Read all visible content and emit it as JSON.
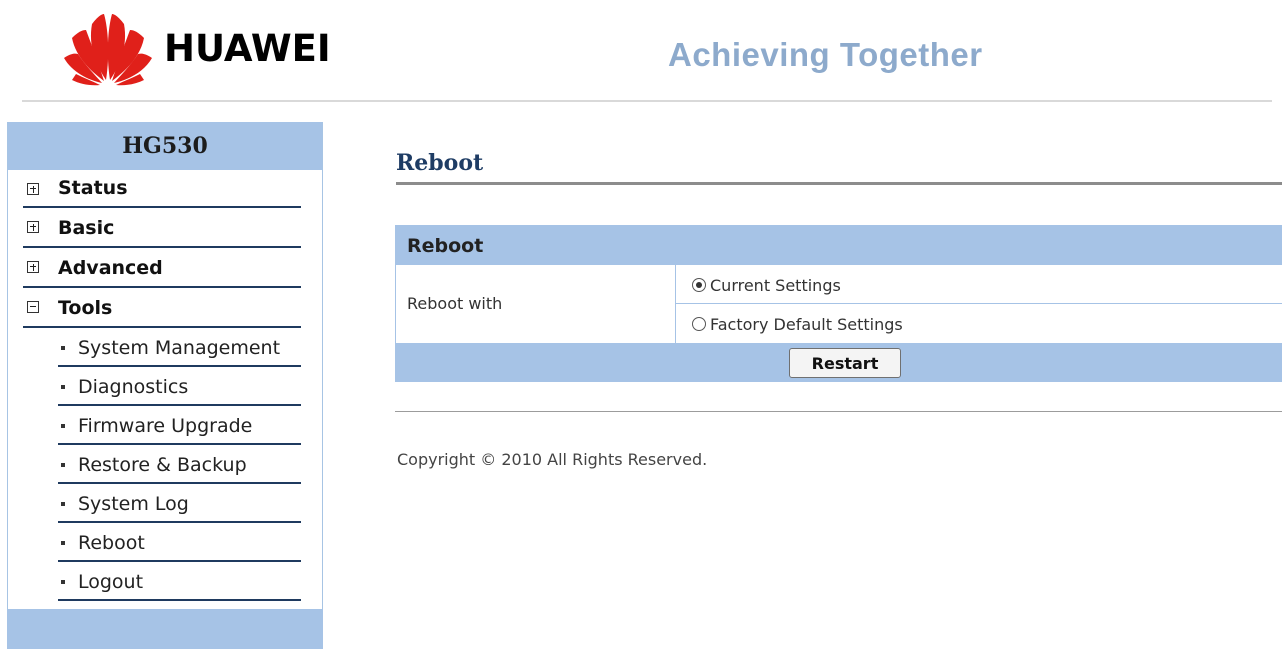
{
  "brand": {
    "name": "HUAWEI",
    "slogan": "Achieving Together",
    "logo_color": "#e0201a"
  },
  "sidebar": {
    "title": "HG530",
    "menu": [
      {
        "label": "Status",
        "expanded": false
      },
      {
        "label": "Basic",
        "expanded": false
      },
      {
        "label": "Advanced",
        "expanded": false
      },
      {
        "label": "Tools",
        "expanded": true
      }
    ],
    "tools_items": [
      {
        "label": "System Management"
      },
      {
        "label": "Diagnostics"
      },
      {
        "label": "Firmware Upgrade"
      },
      {
        "label": "Restore & Backup"
      },
      {
        "label": "System Log"
      },
      {
        "label": "Reboot"
      },
      {
        "label": "Logout"
      }
    ]
  },
  "main": {
    "page_title": "Reboot",
    "section_title": "Reboot",
    "field_label": "Reboot with",
    "options": [
      {
        "label": "Current Settings",
        "selected": true
      },
      {
        "label": "Factory Default Settings",
        "selected": false
      }
    ],
    "restart_label": "Restart",
    "copyright": "Copyright © 2010 All Rights Reserved."
  },
  "colors": {
    "panel_blue": "#a6c3e6",
    "title_navy": "#1e3c64",
    "slogan_blue": "#8daacc"
  }
}
